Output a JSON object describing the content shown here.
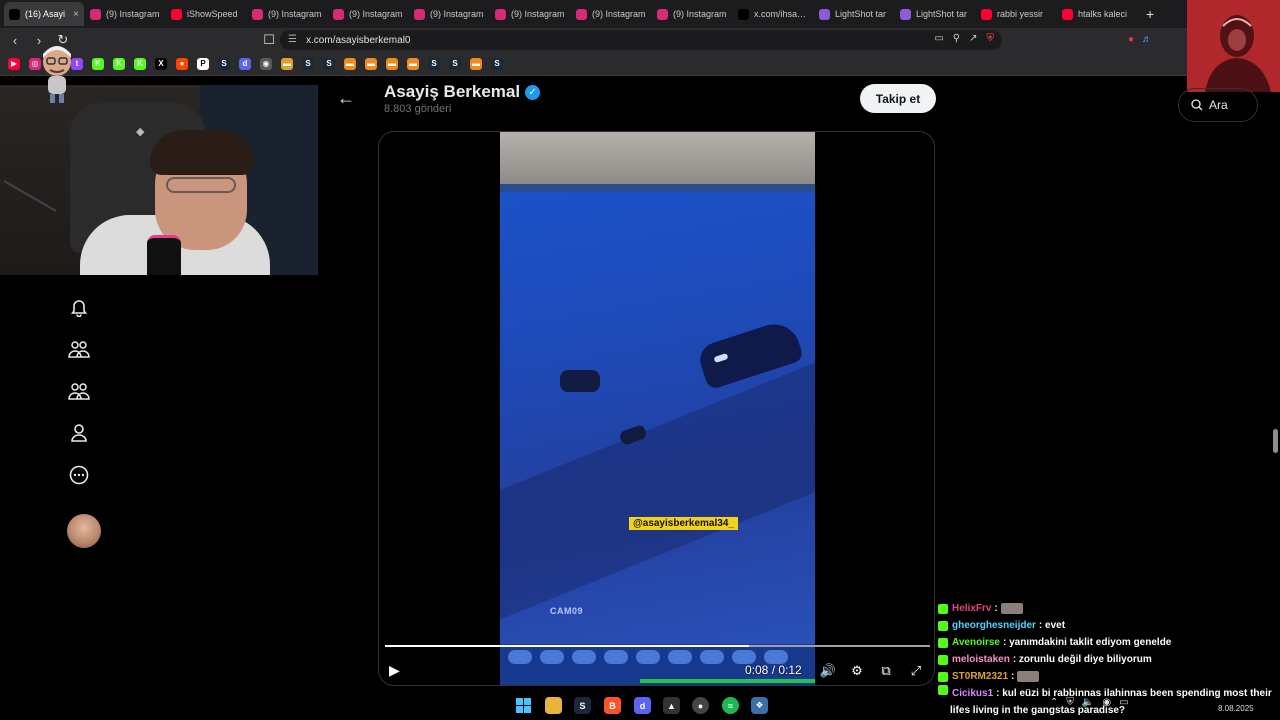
{
  "tabs": [
    {
      "label": "(16) Asayi",
      "icon": "x-logo-icon",
      "color": "#000000",
      "active": true
    },
    {
      "label": "(9) Instagram",
      "icon": "instagram-icon",
      "color": "#d62976"
    },
    {
      "label": "iShowSpeed",
      "icon": "youtube-icon",
      "color": "#ff0033"
    },
    {
      "label": "(9) Instagram",
      "icon": "instagram-icon",
      "color": "#d62976"
    },
    {
      "label": "(9) Instagram",
      "icon": "instagram-icon",
      "color": "#d62976"
    },
    {
      "label": "(9) Instagram",
      "icon": "instagram-icon",
      "color": "#d62976"
    },
    {
      "label": "(9) Instagram",
      "icon": "instagram-icon",
      "color": "#d62976"
    },
    {
      "label": "(9) Instagram",
      "icon": "instagram-icon",
      "color": "#d62976"
    },
    {
      "label": "(9) Instagram",
      "icon": "instagram-icon",
      "color": "#d62976"
    },
    {
      "label": "x.com/ihsanm",
      "icon": "x-logo-icon",
      "color": "#000000"
    },
    {
      "label": "LightShot tar",
      "icon": "lightshot-icon",
      "color": "#8e5bd6"
    },
    {
      "label": "LightShot tar",
      "icon": "lightshot-icon",
      "color": "#8e5bd6"
    },
    {
      "label": "rabbi yessir",
      "icon": "youtube-icon",
      "color": "#ff0033"
    },
    {
      "label": "htalks kaleci",
      "icon": "youtube-icon",
      "color": "#ff0033"
    }
  ],
  "address_bar": {
    "url": "x.com/asayisberkemal0"
  },
  "bookmarks": [
    {
      "icon": "youtube-icon",
      "color": "#ff0033",
      "glyph": "▶"
    },
    {
      "icon": "instagram-icon",
      "color": "#d62976",
      "glyph": "◎"
    },
    {
      "icon": "kick-icon",
      "color": "#53fc18",
      "glyph": "K"
    },
    {
      "icon": "twitch-icon",
      "color": "#9146ff",
      "glyph": "t"
    },
    {
      "icon": "kick-icon",
      "color": "#53fc18",
      "glyph": "K"
    },
    {
      "icon": "kick-icon",
      "color": "#53fc18",
      "glyph": "K"
    },
    {
      "icon": "kick-icon",
      "color": "#53fc18",
      "glyph": "K"
    },
    {
      "icon": "x-logo-icon",
      "color": "#000000",
      "glyph": "X"
    },
    {
      "icon": "reddit-icon",
      "color": "#ff4500",
      "glyph": "●"
    },
    {
      "icon": "patreon-icon",
      "color": "#ffffff",
      "glyph": "P"
    },
    {
      "icon": "steam-icon",
      "color": "#1b2838",
      "glyph": "S"
    },
    {
      "icon": "discord-icon",
      "color": "#5865f2",
      "glyph": "d"
    },
    {
      "icon": "globe-icon",
      "color": "#5a5a5a",
      "glyph": "◉"
    },
    {
      "icon": "folder-icon",
      "color": "#e0a030",
      "glyph": "▬"
    },
    {
      "icon": "steam-icon",
      "color": "#1b2838",
      "glyph": "S"
    },
    {
      "icon": "steam-icon",
      "color": "#1b2838",
      "glyph": "S"
    },
    {
      "icon": "bookmark-icon",
      "color": "#f08b1d",
      "glyph": "▬"
    },
    {
      "icon": "bookmark-icon",
      "color": "#f08b1d",
      "glyph": "▬"
    },
    {
      "icon": "bookmark-icon",
      "color": "#f08b1d",
      "glyph": "▬"
    },
    {
      "icon": "bookmark-icon",
      "color": "#f08b1d",
      "glyph": "▬"
    },
    {
      "icon": "steam-icon",
      "color": "#1b2838",
      "glyph": "S"
    },
    {
      "icon": "steam-icon",
      "color": "#1b2838",
      "glyph": "S"
    },
    {
      "icon": "bookmark-icon",
      "color": "#f08b1d",
      "glyph": "▬"
    },
    {
      "icon": "steam-icon",
      "color": "#1b2838",
      "glyph": "S"
    }
  ],
  "sidebar": {
    "items": [
      {
        "name": "notifications",
        "icon": "bell-icon"
      },
      {
        "name": "communities",
        "icon": "communities-icon"
      },
      {
        "name": "groups",
        "icon": "groups-icon"
      },
      {
        "name": "profile",
        "icon": "person-icon"
      },
      {
        "name": "more",
        "icon": "more-circle-icon"
      }
    ]
  },
  "profile": {
    "name": "Asayiş Berkemal",
    "post_count": "8.803 gönderi",
    "follow_label": "Takip et"
  },
  "search": {
    "placeholder": "Ara"
  },
  "video": {
    "watermark": "@asayisberkemal34_",
    "camera_label": "CAM09",
    "time": "0:08 / 0:12",
    "progress": 0.667
  },
  "chat": [
    {
      "user": "HelixFrv",
      "color": "#e0447a",
      "text": "",
      "emote": true
    },
    {
      "user": "gheorghesneijder",
      "color": "#53d1ff",
      "text": "evet"
    },
    {
      "user": "Avenoirse",
      "color": "#53fc18",
      "text": "yanımdakini taklit ediyom genelde"
    },
    {
      "user": "meloistaken",
      "color": "#ff8fc7",
      "text": "zorunlu değil diye biliyorum"
    },
    {
      "user": "ST0RM2321",
      "color": "#e0a030",
      "text": "",
      "emote": true
    },
    {
      "user": "Cicikus1",
      "color": "#d48bff",
      "text": "kul eüzi bi rabbinnas ilahinnas been spending most their lifes living in the gangstas paradise?"
    }
  ],
  "taskbar": {
    "date": "8.08.2025"
  }
}
